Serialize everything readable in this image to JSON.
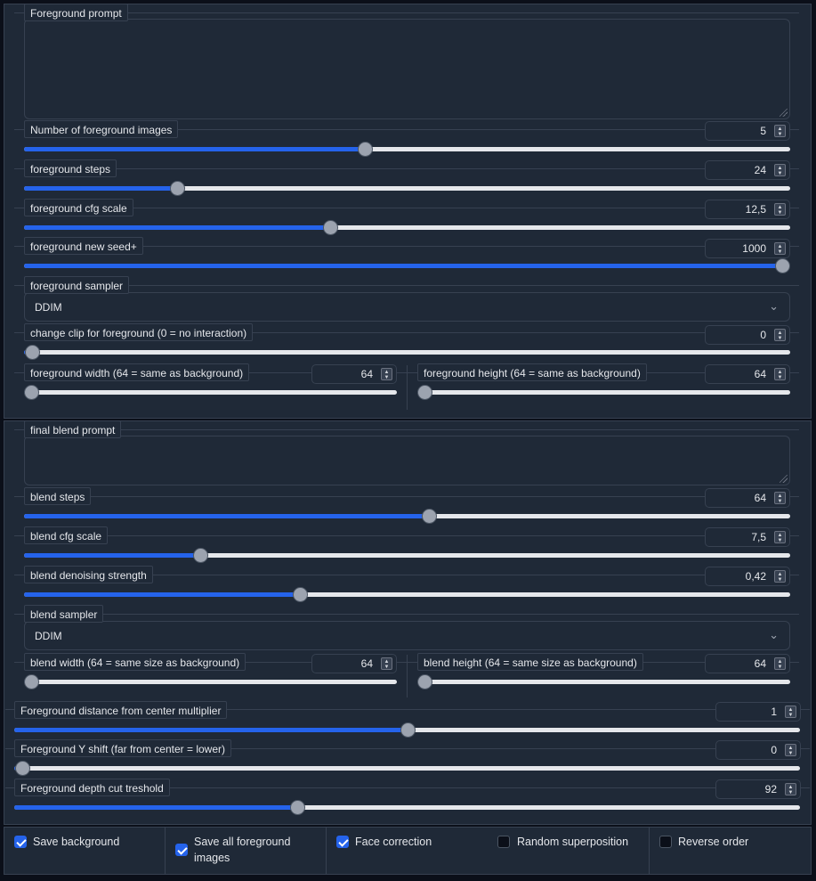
{
  "foreground": {
    "prompt_label": "Foreground prompt",
    "prompt_value": "",
    "num_images": {
      "label": "Number of foreground images",
      "value": "5",
      "fraction": 0.445
    },
    "steps": {
      "label": "foreground steps",
      "value": "24",
      "fraction": 0.2
    },
    "cfg_scale": {
      "label": "foreground cfg scale",
      "value": "12,5",
      "fraction": 0.4
    },
    "new_seed": {
      "label": "foreground new seed+",
      "value": "1000",
      "fraction": 1.0
    },
    "sampler": {
      "label": "foreground sampler",
      "value": "DDIM"
    },
    "change_clip": {
      "label": "change clip for foreground (0 = no interaction)",
      "value": "0",
      "fraction": 0.01
    },
    "width": {
      "label": "foreground width (64 = same as background)",
      "value": "64",
      "fraction": 0.02
    },
    "height": {
      "label": "foreground height (64 = same as background)",
      "value": "64",
      "fraction": 0.0
    }
  },
  "blend": {
    "prompt_label": "final blend prompt",
    "prompt_value": "",
    "steps": {
      "label": "blend steps",
      "value": "64",
      "fraction": 0.529
    },
    "cfg_scale": {
      "label": "blend cfg scale",
      "value": "7,5",
      "fraction": 0.23
    },
    "denoising": {
      "label": "blend denoising strength",
      "value": "0,42",
      "fraction": 0.36
    },
    "sampler": {
      "label": "blend sampler",
      "value": "DDIM"
    },
    "width": {
      "label": "blend width (64 = same size as background)",
      "value": "64",
      "fraction": 0.02
    },
    "height": {
      "label": "blend height (64 = same size as background)",
      "value": "64",
      "fraction": 0.0
    }
  },
  "placement": {
    "distance": {
      "label": "Foreground distance from center multiplier",
      "value": "1",
      "fraction": 0.5
    },
    "y_shift": {
      "label": "Foreground Y shift (far from center = lower)",
      "value": "0",
      "fraction": 0.01
    },
    "depth_cut": {
      "label": "Foreground depth cut treshold",
      "value": "92",
      "fraction": 0.36
    }
  },
  "options": [
    {
      "label": "Save background",
      "checked": true
    },
    {
      "label": "Save all foreground images",
      "checked": true
    },
    {
      "label": "Face correction",
      "checked": true
    },
    {
      "label": "Random superposition",
      "checked": false
    },
    {
      "label": "Reverse order",
      "checked": false
    }
  ],
  "icons": {
    "dropdown": "chevron-down-icon",
    "spinner": "spinner-arrows-icon",
    "resize": "resize-grip-icon"
  },
  "colors": {
    "accent": "#2563eb",
    "panel": "#1f2937",
    "border": "#374151",
    "background": "#0b0f19"
  }
}
